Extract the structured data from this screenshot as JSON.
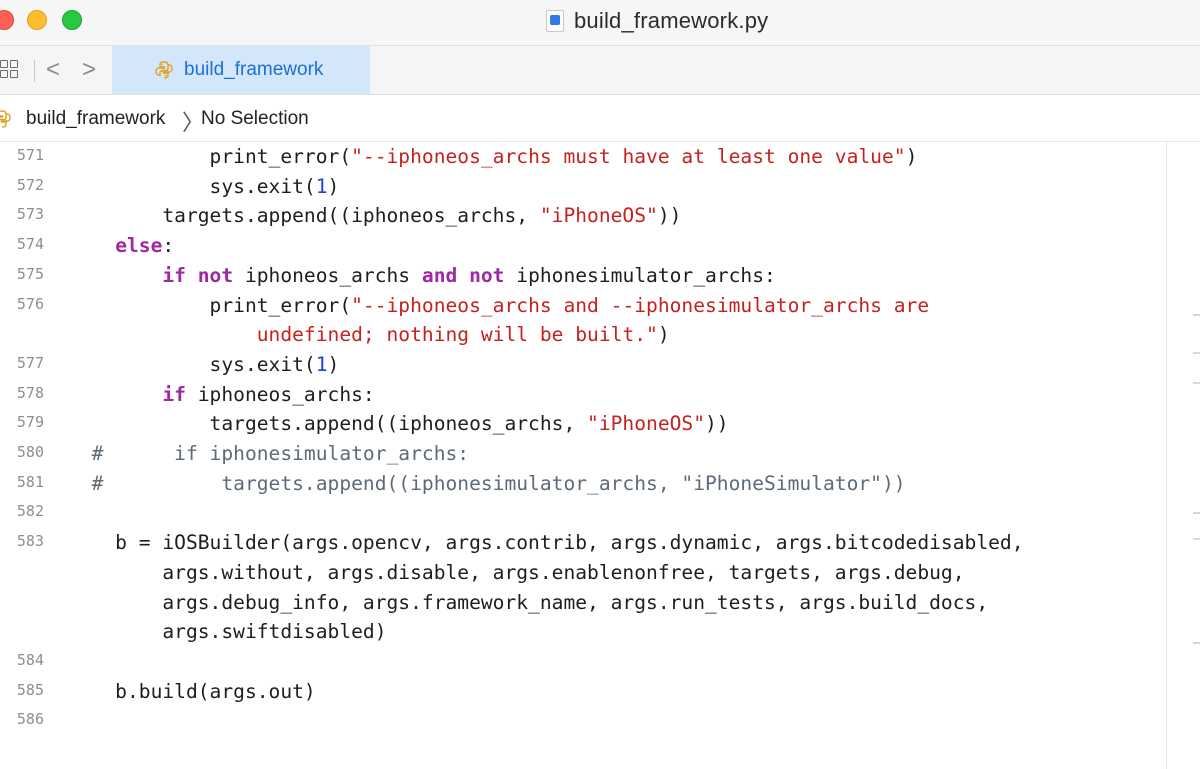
{
  "window": {
    "title": "build_framework.py"
  },
  "tabbar": {
    "back_glyph": "<",
    "forward_glyph": ">",
    "active_tab": "build_framework"
  },
  "breadcrumb": {
    "file": "build_framework",
    "separator": "〉",
    "selection": "No Selection"
  },
  "icons": {
    "window_file": "python-file-icon",
    "tab_file": "python-icon",
    "grid": "grid-view-icon"
  },
  "editor": {
    "lines": [
      {
        "num": "571",
        "segments": [
          {
            "t": "            print_error(",
            "c": ""
          },
          {
            "t": "\"--iphoneos_archs must have at least one value\"",
            "c": "str"
          },
          {
            "t": ")",
            "c": ""
          }
        ]
      },
      {
        "num": "572",
        "segments": [
          {
            "t": "            sys.exit(",
            "c": ""
          },
          {
            "t": "1",
            "c": "num"
          },
          {
            "t": ")",
            "c": ""
          }
        ]
      },
      {
        "num": "573",
        "segments": [
          {
            "t": "        targets.append((iphoneos_archs, ",
            "c": ""
          },
          {
            "t": "\"iPhoneOS\"",
            "c": "str"
          },
          {
            "t": "))",
            "c": ""
          }
        ]
      },
      {
        "num": "574",
        "segments": [
          {
            "t": "    ",
            "c": ""
          },
          {
            "t": "else",
            "c": "kw"
          },
          {
            "t": ":",
            "c": ""
          }
        ]
      },
      {
        "num": "575",
        "segments": [
          {
            "t": "        ",
            "c": ""
          },
          {
            "t": "if",
            "c": "kw"
          },
          {
            "t": " ",
            "c": ""
          },
          {
            "t": "not",
            "c": "kw"
          },
          {
            "t": " iphoneos_archs ",
            "c": ""
          },
          {
            "t": "and",
            "c": "kw"
          },
          {
            "t": " ",
            "c": ""
          },
          {
            "t": "not",
            "c": "kw"
          },
          {
            "t": " iphonesimulator_archs:",
            "c": ""
          }
        ]
      },
      {
        "num": "576",
        "segments": [
          {
            "t": "            print_error(",
            "c": ""
          },
          {
            "t": "\"--iphoneos_archs and --iphonesimulator_archs are",
            "c": "str"
          }
        ]
      },
      {
        "num": "",
        "segments": [
          {
            "t": "                ",
            "c": ""
          },
          {
            "t": "undefined; nothing will be built.\"",
            "c": "str"
          },
          {
            "t": ")",
            "c": ""
          }
        ]
      },
      {
        "num": "577",
        "segments": [
          {
            "t": "            sys.exit(",
            "c": ""
          },
          {
            "t": "1",
            "c": "num"
          },
          {
            "t": ")",
            "c": ""
          }
        ]
      },
      {
        "num": "578",
        "segments": [
          {
            "t": "        ",
            "c": ""
          },
          {
            "t": "if",
            "c": "kw"
          },
          {
            "t": " iphoneos_archs:",
            "c": ""
          }
        ]
      },
      {
        "num": "579",
        "segments": [
          {
            "t": "            targets.append((iphoneos_archs, ",
            "c": ""
          },
          {
            "t": "\"iPhoneOS\"",
            "c": "str"
          },
          {
            "t": "))",
            "c": ""
          }
        ]
      },
      {
        "num": "580",
        "segments": [
          {
            "t": "  #      if iphonesimulator_archs:",
            "c": "cmt"
          }
        ]
      },
      {
        "num": "581",
        "segments": [
          {
            "t": "  #          targets.append((iphonesimulator_archs, \"iPhoneSimulator\"))",
            "c": "cmt"
          }
        ]
      },
      {
        "num": "582",
        "segments": [
          {
            "t": "",
            "c": ""
          }
        ]
      },
      {
        "num": "583",
        "segments": [
          {
            "t": "    b = iOSBuilder(args.opencv, args.contrib, args.dynamic, args.bitcodedisabled,",
            "c": ""
          }
        ]
      },
      {
        "num": "",
        "segments": [
          {
            "t": "        args.without, args.disable, args.enablenonfree, targets, args.debug,",
            "c": ""
          }
        ]
      },
      {
        "num": "",
        "segments": [
          {
            "t": "        args.debug_info, args.framework_name, args.run_tests, args.build_docs,",
            "c": ""
          }
        ]
      },
      {
        "num": "",
        "segments": [
          {
            "t": "        args.swiftdisabled)",
            "c": ""
          }
        ]
      },
      {
        "num": "584",
        "segments": [
          {
            "t": "",
            "c": ""
          }
        ]
      },
      {
        "num": "585",
        "segments": [
          {
            "t": "    b.build(args.out)",
            "c": ""
          }
        ]
      },
      {
        "num": "586",
        "segments": [
          {
            "t": "",
            "c": ""
          }
        ]
      }
    ]
  }
}
